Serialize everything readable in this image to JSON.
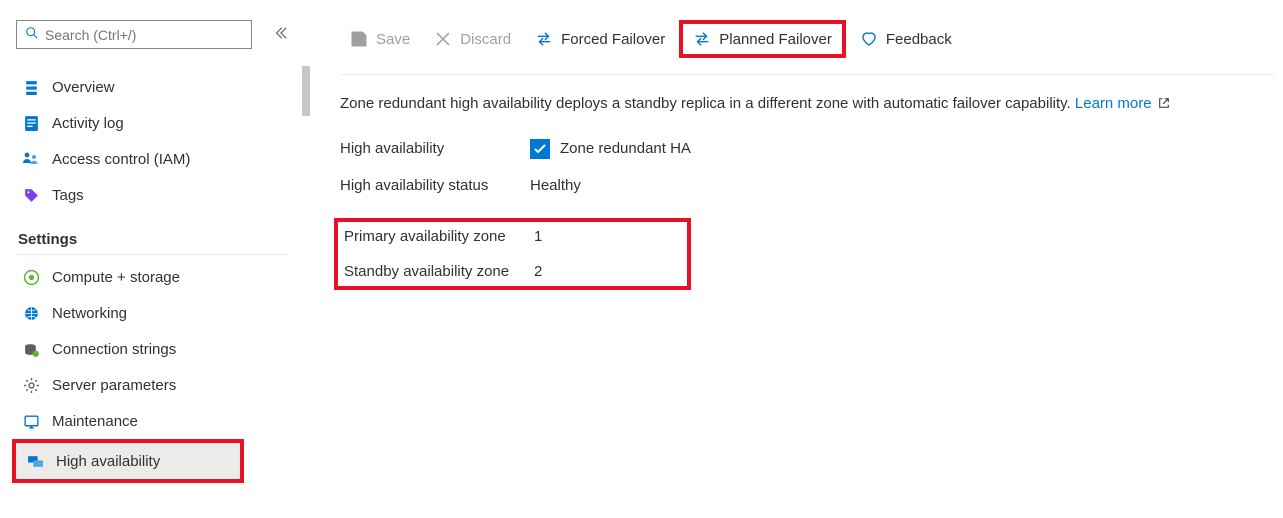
{
  "search": {
    "placeholder": "Search (Ctrl+/)"
  },
  "nav": {
    "overview": "Overview",
    "activity_log": "Activity log",
    "access_control": "Access control (IAM)",
    "tags": "Tags",
    "settings_header": "Settings",
    "compute_storage": "Compute + storage",
    "networking": "Networking",
    "connection_strings": "Connection strings",
    "server_parameters": "Server parameters",
    "maintenance": "Maintenance",
    "high_availability": "High availability"
  },
  "toolbar": {
    "save": "Save",
    "discard": "Discard",
    "forced_failover": "Forced Failover",
    "planned_failover": "Planned Failover",
    "feedback": "Feedback"
  },
  "content": {
    "description": "Zone redundant high availability deploys a standby replica in a different zone with automatic failover capability. ",
    "learn_more": "Learn more",
    "ha_label": "High availability",
    "ha_checkbox_label": "Zone redundant HA",
    "ha_status_label": "High availability status",
    "ha_status_value": "Healthy",
    "primary_zone_label": "Primary availability zone",
    "primary_zone_value": "1",
    "standby_zone_label": "Standby availability zone",
    "standby_zone_value": "2"
  }
}
